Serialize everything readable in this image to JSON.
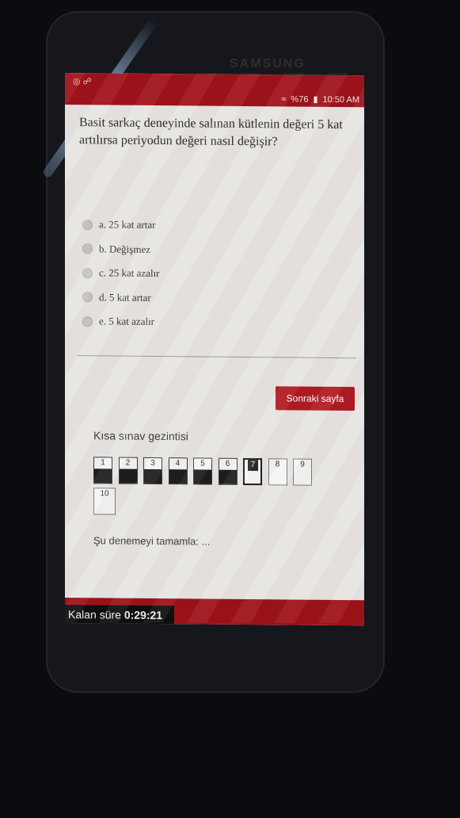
{
  "device": {
    "brand": "SAMSUNG"
  },
  "status_bar": {
    "battery": "%76",
    "time": "10:50 AM"
  },
  "question": {
    "text": "Basit sarkaç deneyinde salınan kütlenin değeri 5 kat artılırsa periyodun değeri nasıl değişir?"
  },
  "options": [
    {
      "label": "a. 25 kat artar"
    },
    {
      "label": "b. Değişmez"
    },
    {
      "label": "c. 25 kat azalır"
    },
    {
      "label": "d. 5 kat artar"
    },
    {
      "label": "e. 5 kat azalır"
    }
  ],
  "next_button": {
    "label": "Sonraki sayfa"
  },
  "quiz_nav": {
    "title": "Kısa sınav gezintisi",
    "cells": [
      {
        "num": "1",
        "state": "done"
      },
      {
        "num": "2",
        "state": "done"
      },
      {
        "num": "3",
        "state": "done"
      },
      {
        "num": "4",
        "state": "done"
      },
      {
        "num": "5",
        "state": "done"
      },
      {
        "num": "6",
        "state": "done"
      },
      {
        "num": "7",
        "state": "current"
      },
      {
        "num": "8",
        "state": "todo"
      },
      {
        "num": "9",
        "state": "todo"
      },
      {
        "num": "10",
        "state": "todo"
      }
    ]
  },
  "finish_link": {
    "label": "Şu denemeyi tamamla: ..."
  },
  "timer": {
    "label": "Kalan süre",
    "value": "0:29:21"
  },
  "colors": {
    "brand_red": "#a0121a",
    "button_red": "#b11b22"
  }
}
